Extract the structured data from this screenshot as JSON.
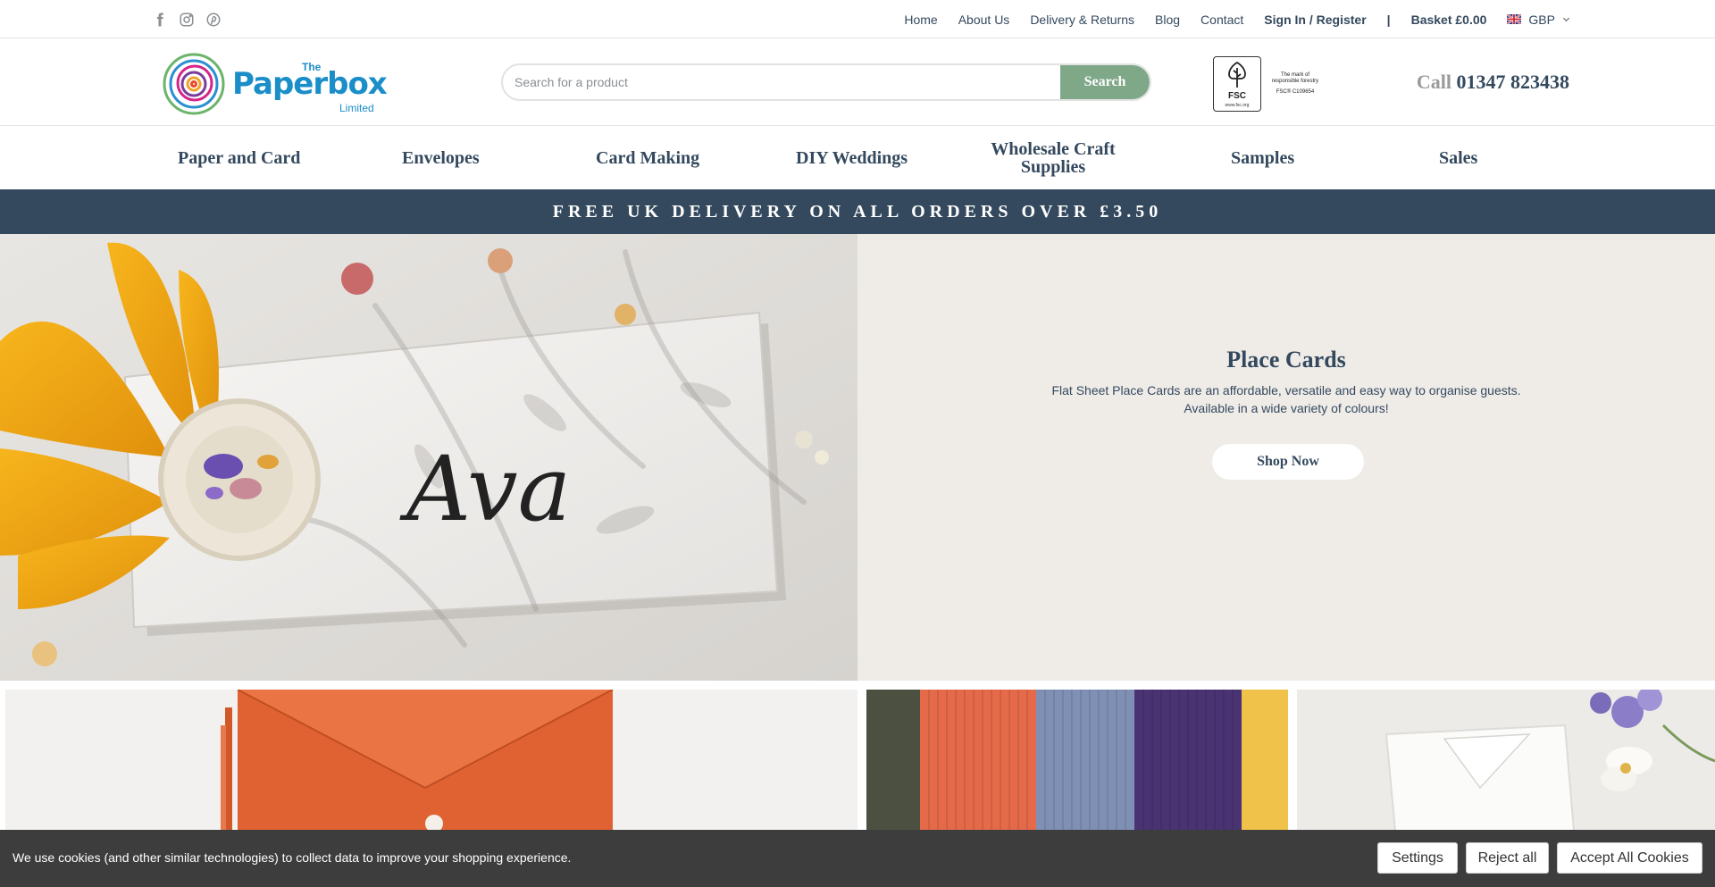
{
  "social": {
    "icons": [
      "facebook-icon",
      "instagram-icon",
      "pinterest-icon"
    ],
    "icon_color": "#8a8f93"
  },
  "top_nav": {
    "links": [
      "Home",
      "About Us",
      "Delivery & Returns",
      "Blog",
      "Contact"
    ],
    "sign_in": "Sign In / Register",
    "separator": "|",
    "basket": "Basket £0.00",
    "currency": "GBP"
  },
  "header": {
    "logo": {
      "prefix": "The",
      "name": "Paperbox",
      "suffix": "Limited"
    },
    "search": {
      "placeholder": "Search for a product",
      "value": "",
      "button_label": "Search"
    },
    "fsc": {
      "label": "FSC",
      "url": "www.fsc.org",
      "tagline": "The mark of responsible forestry",
      "code": "FSC® C109654"
    },
    "phone": {
      "prefix": "Call",
      "number": "01347 823438"
    }
  },
  "main_nav": [
    {
      "label": "Paper and Card",
      "has_dropdown": true
    },
    {
      "label": "Envelopes",
      "has_dropdown": true
    },
    {
      "label": "Card Making",
      "has_dropdown": true
    },
    {
      "label": "DIY Weddings",
      "has_dropdown": true
    },
    {
      "label": "Wholesale Craft Supplies",
      "has_dropdown": true
    },
    {
      "label": "Samples",
      "has_dropdown": false
    },
    {
      "label": "Sales",
      "has_dropdown": true
    }
  ],
  "promo": {
    "text": "FREE UK DELIVERY ON ALL ORDERS OVER £3.50",
    "background": "#34495e"
  },
  "hero": {
    "image_text": "Ava",
    "title": "Place Cards",
    "description": "Flat Sheet Place Cards are an affordable, versatile and easy way to organise guests. Available in a wide variety of colours!",
    "button_label": "Shop Now",
    "panel_background": "#efece8"
  },
  "tiles": [
    {
      "name": "orange-envelopes-image"
    },
    {
      "name": "coloured-card-stack-image"
    },
    {
      "name": "white-envelope-flowers-image"
    }
  ],
  "cookie_bar": {
    "text": "We use cookies (and other similar technologies) to collect data to improve your shopping experience.",
    "settings_label": "Settings",
    "reject_label": "Reject all",
    "accept_label": "Accept All Cookies"
  },
  "colors": {
    "brand_navy": "#34495e",
    "brand_green": "#7fa889",
    "brand_blue": "#1a8ec8"
  }
}
